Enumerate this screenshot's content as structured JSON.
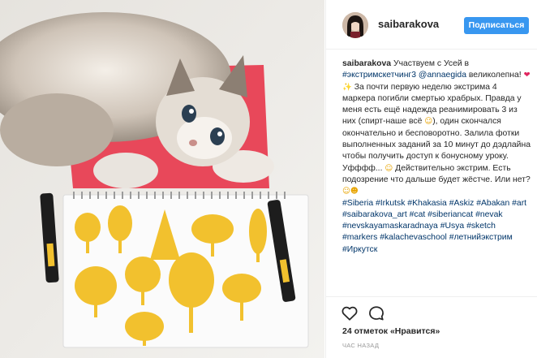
{
  "photo": {
    "description_icon": "post-photo"
  },
  "header": {
    "username": "saibarakova",
    "follow_label": "Подписаться"
  },
  "caption": {
    "username": "saibarakova",
    "t1": "Участвуем с Усей в",
    "tag_challenge": "#экстримскетчинг3",
    "mention": "@annaegida",
    "t2": "великолепна!",
    "t3": "За почти первую неделю экстрима 4 маркера погибли смертью храбрых. Правда у меня есть ещё надежда реанимировать 3 из них (спирт-наше всё",
    "t4": "), один скончался окончательно и бесповоротно. Залила фотки выполненных заданий за 10 минут до дэдлайна чтобы получить доступ к бонусному уроку. Уфффф...",
    "t5": "Действительно экстрим. Есть подозрение что дальше будет жёстче. Или нет?",
    "hashtags": [
      "#Siberia",
      "#Irkutsk",
      "#Khakasia",
      "#Askiz",
      "#Abakan",
      "#art",
      "#saibarakova_art",
      "#cat",
      "#siberiancat",
      "#nevak",
      "#nevskayamaskaradnaya",
      "#Usya",
      "#sketch",
      "#markers",
      "#kalachevaschool",
      "#летнийэкстрим",
      "#Иркутск"
    ]
  },
  "actions": {
    "like_icon": "heart-outline-icon",
    "comment_icon": "comment-bubble-icon"
  },
  "likes": "24 отметок «Нравится»",
  "time": "ЧАС НАЗАД",
  "colors": {
    "accent": "#3897f0",
    "link": "#003569",
    "marker_yellow": "#f2c12e"
  }
}
